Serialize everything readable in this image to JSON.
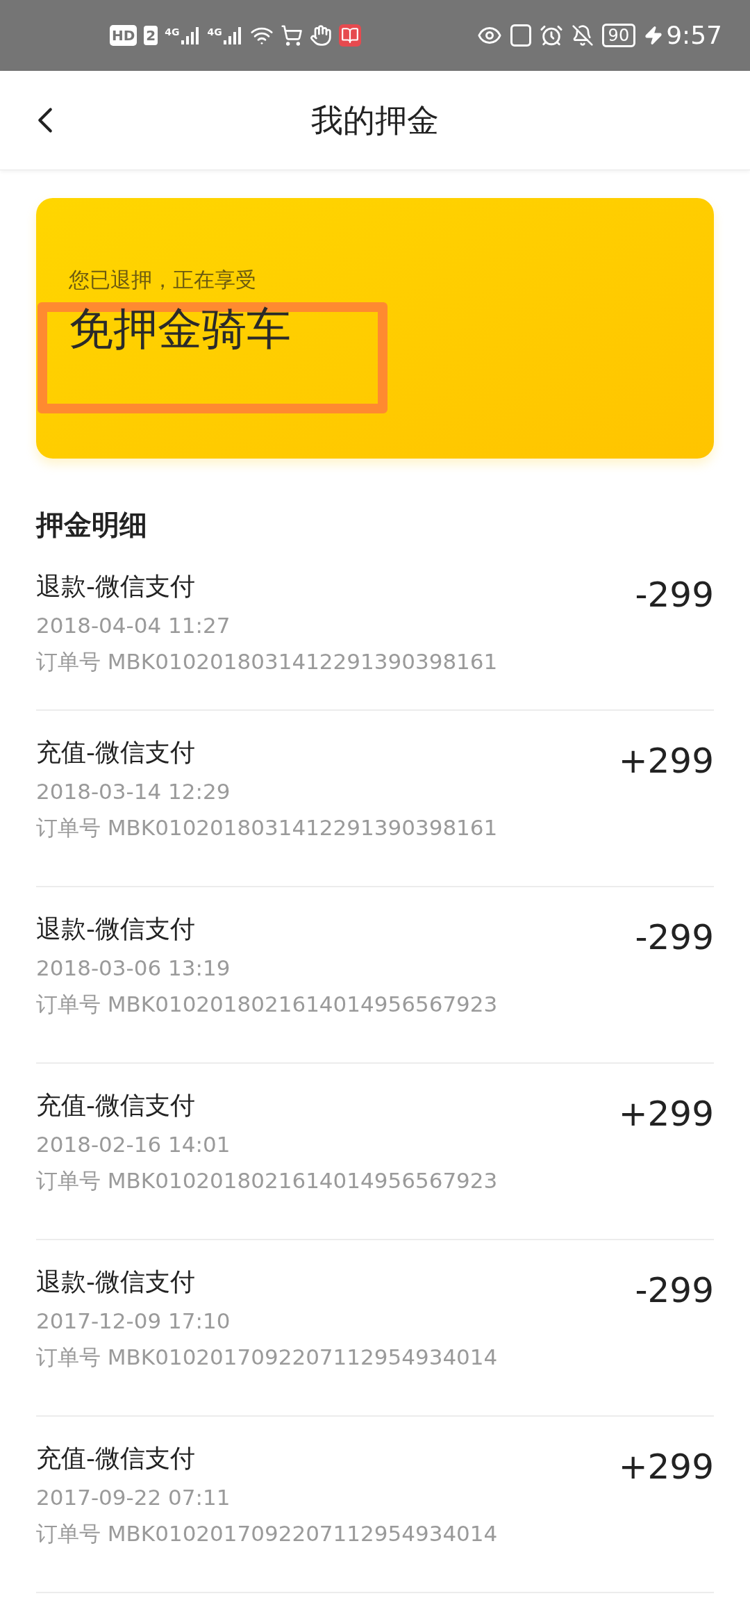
{
  "status_bar": {
    "hd": "HD",
    "sim": "2",
    "networks": [
      "4G",
      "4G"
    ],
    "battery": "90",
    "time": "9:57"
  },
  "header": {
    "title": "我的押金"
  },
  "card": {
    "subtitle": "您已退押，正在享受",
    "title": "免押金骑车",
    "highlighted": true
  },
  "section": {
    "title": "押金明细"
  },
  "records": [
    {
      "title": "退款-微信支付",
      "date": "2018-04-04 11:27",
      "order": "订单号 MBK0102018031412291390398161",
      "amount": "-299"
    },
    {
      "title": "充值-微信支付",
      "date": "2018-03-14 12:29",
      "order": "订单号 MBK0102018031412291390398161",
      "amount": "+299"
    },
    {
      "title": "退款-微信支付",
      "date": "2018-03-06 13:19",
      "order": "订单号 MBK0102018021614014956567923",
      "amount": "-299"
    },
    {
      "title": "充值-微信支付",
      "date": "2018-02-16 14:01",
      "order": "订单号 MBK0102018021614014956567923",
      "amount": "+299"
    },
    {
      "title": "退款-微信支付",
      "date": "2017-12-09 17:10",
      "order": "订单号 MBK0102017092207112954934014",
      "amount": "-299"
    },
    {
      "title": "充值-微信支付",
      "date": "2017-09-22 07:11",
      "order": "订单号 MBK0102017092207112954934014",
      "amount": "+299"
    }
  ]
}
